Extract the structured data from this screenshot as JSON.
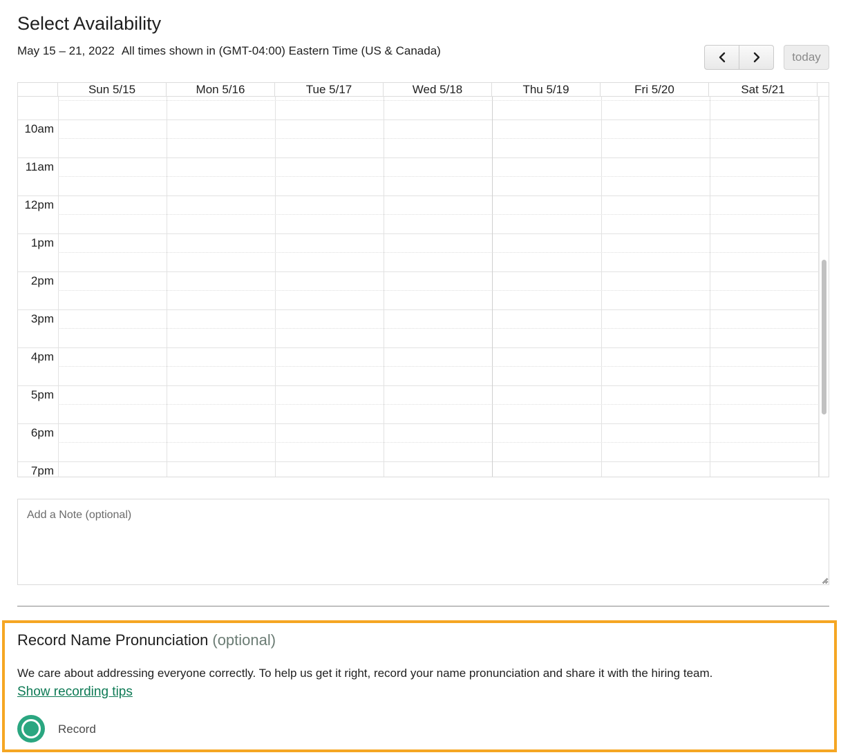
{
  "header": {
    "title": "Select Availability",
    "date_range": "May 15 – 21, 2022",
    "timezone": "All times shown in (GMT-04:00) Eastern Time (US & Canada)"
  },
  "toolbar": {
    "prev_icon": "chevron-left-icon",
    "next_icon": "chevron-right-icon",
    "today_label": "today"
  },
  "calendar": {
    "days": [
      "Sun 5/15",
      "Mon 5/16",
      "Tue 5/17",
      "Wed 5/18",
      "Thu 5/19",
      "Fri 5/20",
      "Sat 5/21"
    ],
    "times": [
      "10am",
      "11am",
      "12pm",
      "1pm",
      "2pm",
      "3pm",
      "4pm",
      "5pm",
      "6pm",
      "7pm"
    ]
  },
  "note": {
    "placeholder": "Add a Note (optional)"
  },
  "pronunciation": {
    "title": "Record Name Pronunciation",
    "optional": "(optional)",
    "description": "We care about addressing everyone correctly. To help us get it right, record your name pronunciation and share it with the hiring team.",
    "tips_link": "Show recording tips",
    "record_label": "Record",
    "record_icon": "record-icon"
  },
  "colors": {
    "highlight": "#f5a623",
    "accent_green": "#2aa680",
    "link_green": "#0e7a55"
  }
}
